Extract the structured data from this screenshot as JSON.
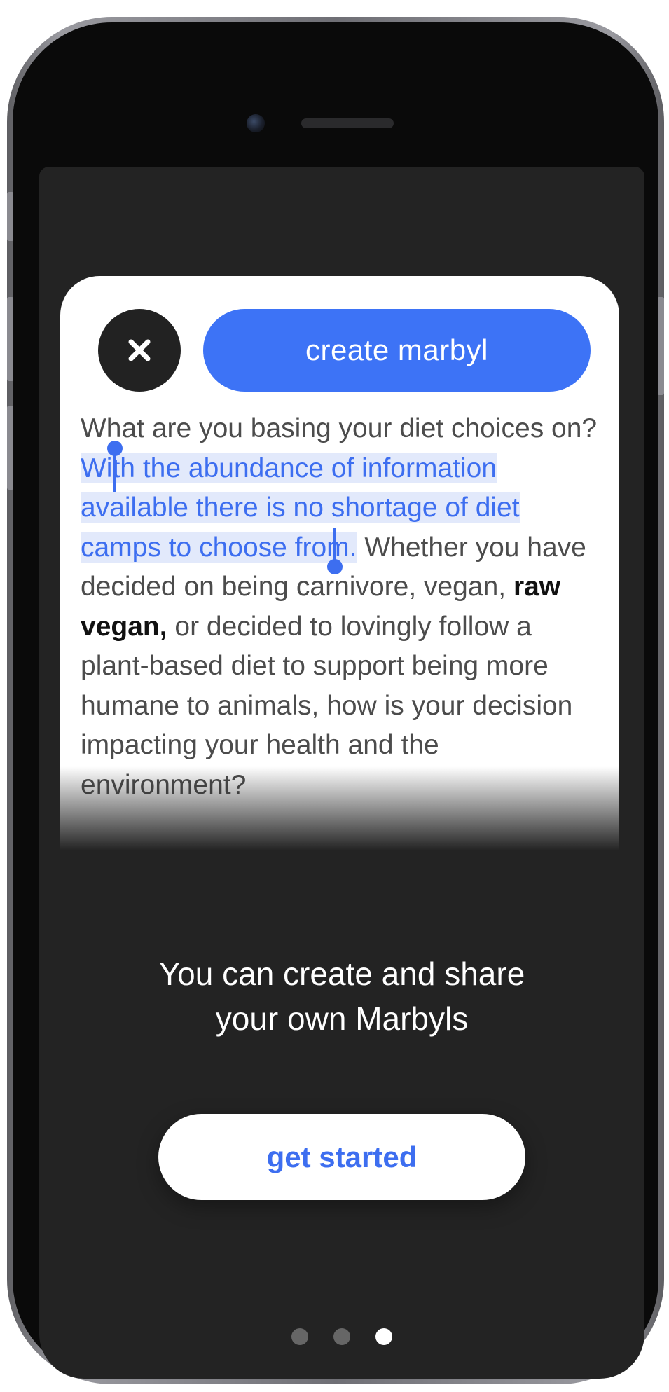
{
  "card": {
    "create_label": "create marbyl",
    "article": {
      "before_selection": "What are you basing your diet choices on? ",
      "selected": "With the abundance of information available there is no shortage of diet camps to choose from.",
      "middle": " Whether you have decided on being carnivore, vegan, ",
      "bold": "raw vegan,",
      "after": " or decided to lovingly follow a plant-based diet to support being more humane to animals, how is your decision impacting your health and the environment?"
    }
  },
  "onboarding": {
    "headline_line1": "You can create and share",
    "headline_line2": "your own Marbyls",
    "cta_label": "get started",
    "page_count": 3,
    "active_page": 3
  },
  "icons": {
    "close": "close-icon"
  },
  "colors": {
    "accent": "#3d73f6",
    "screen_bg": "#232323",
    "card_bg": "#ffffff",
    "selection_bg": "#e2e9fb"
  }
}
